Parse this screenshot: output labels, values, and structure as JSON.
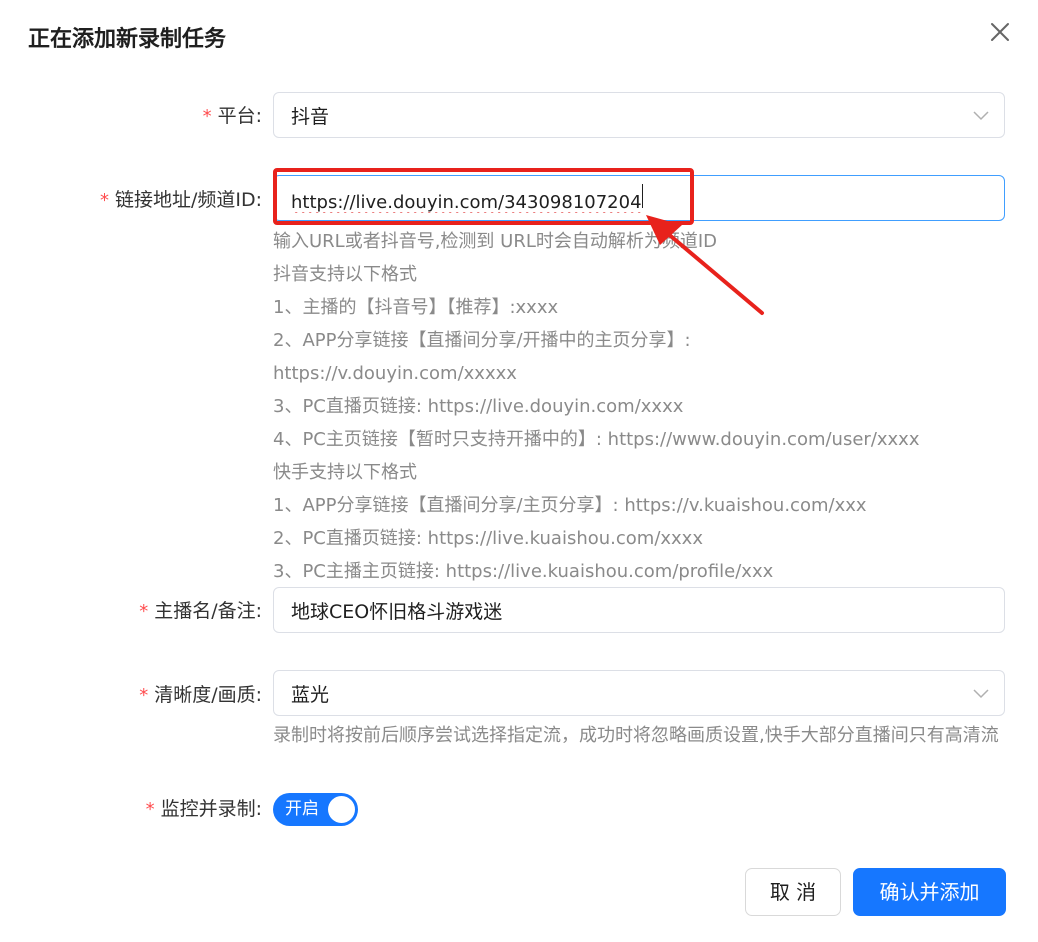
{
  "dialog": {
    "title": "正在添加新录制任务"
  },
  "form": {
    "platform": {
      "label": "平台:",
      "value": "抖音"
    },
    "url": {
      "label": "链接地址/频道ID:",
      "value": "https://live.douyin.com/343098107204",
      "help": [
        "输入URL或者抖音号,检测到 URL时会自动解析为频道ID",
        "抖音支持以下格式",
        "1、主播的【抖音号】【推荐】:xxxx",
        "2、APP分享链接【直播间分享/开播中的主页分享】:",
        "https://v.douyin.com/xxxxx",
        "3、PC直播页链接: https://live.douyin.com/xxxx",
        "4、PC主页链接【暂时只支持开播中的】: https://www.douyin.com/user/xxxx",
        "快手支持以下格式",
        "1、APP分享链接【直播间分享/主页分享】: https://v.kuaishou.com/xxx",
        "2、PC直播页链接: https://live.kuaishou.com/xxxx",
        "3、PC主播主页链接: https://live.kuaishou.com/profile/xxx"
      ]
    },
    "streamer": {
      "label": "主播名/备注:",
      "value": "地球CEO怀旧格斗游戏迷"
    },
    "quality": {
      "label": "清晰度/画质:",
      "value": "蓝光",
      "help": "录制时将按前后顺序尝试选择指定流，成功时将忽略画质设置,快手大部分直播间只有高清流"
    },
    "monitor": {
      "label": "监控并录制:",
      "switch_text": "开启",
      "enabled": true
    },
    "required_mark": "*"
  },
  "footer": {
    "cancel_label": "取 消",
    "confirm_label": "确认并添加"
  },
  "icons": {
    "close": "close-icon",
    "chevron": "chevron-down-icon"
  },
  "colors": {
    "primary": "#1677ff",
    "required": "#ff4d4f",
    "annotation": "#e8221c",
    "help_text": "#8a8a8a"
  }
}
